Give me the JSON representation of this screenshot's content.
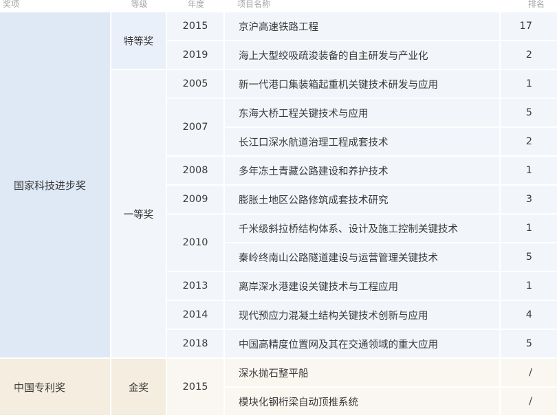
{
  "headers": {
    "award": "奖项",
    "grade": "等级",
    "year": "年度",
    "name": "项目名称",
    "rank": "排名"
  },
  "groups": [
    {
      "award": "国家科技进步奖",
      "grades": [
        {
          "grade": "特等奖",
          "years": [
            {
              "year": "2015",
              "items": [
                {
                  "name": "京沪高速铁路工程",
                  "rank": "17"
                }
              ]
            },
            {
              "year": "2019",
              "items": [
                {
                  "name": "海上大型绞吸疏浚装备的自主研发与产业化",
                  "rank": "2"
                }
              ]
            }
          ]
        },
        {
          "grade": "一等奖",
          "years": [
            {
              "year": "2005",
              "items": [
                {
                  "name": "新一代港口集装箱起重机关键技术研发与应用",
                  "rank": "1"
                }
              ]
            },
            {
              "year": "2007",
              "items": [
                {
                  "name": "东海大桥工程关键技术与应用",
                  "rank": "5"
                },
                {
                  "name": "长江口深水航道治理工程成套技术",
                  "rank": "2"
                }
              ]
            },
            {
              "year": "2008",
              "items": [
                {
                  "name": "多年冻土青藏公路建设和养护技术",
                  "rank": "1"
                }
              ]
            },
            {
              "year": "2009",
              "items": [
                {
                  "name": "膨胀土地区公路修筑成套技术研究",
                  "rank": "3"
                }
              ]
            },
            {
              "year": "2010",
              "items": [
                {
                  "name": "千米级斜拉桥结构体系、设计及施工控制关键技术",
                  "rank": "1"
                },
                {
                  "name": "秦岭终南山公路隧道建设与运营管理关键技术",
                  "rank": "5"
                }
              ]
            },
            {
              "year": "2013",
              "items": [
                {
                  "name": "离岸深水港建设关键技术与工程应用",
                  "rank": "1"
                }
              ]
            },
            {
              "year": "2014",
              "items": [
                {
                  "name": "现代预应力混凝土结构关键技术创新与应用",
                  "rank": "4"
                }
              ]
            },
            {
              "year": "2018",
              "items": [
                {
                  "name": "中国高精度位置网及其在交通领域的重大应用",
                  "rank": "5"
                }
              ]
            }
          ]
        }
      ]
    },
    {
      "award": "中国专利奖",
      "grades": [
        {
          "grade": "金奖",
          "years": [
            {
              "year": "2015",
              "items": [
                {
                  "name": "深水抛石整平船",
                  "rank": "/"
                },
                {
                  "name": "模块化钢桁梁自动顶推系统",
                  "rank": "/"
                }
              ]
            }
          ]
        }
      ]
    }
  ],
  "colors": {
    "blue_dark": "#dfe9f6",
    "blue_mid": "#e9f0f9",
    "blue_light": "#f2f6fb",
    "cream_dark": "#f4ede0",
    "cream_light": "#faf7f0",
    "header_text": "#a5a5a5",
    "body_text": "#3a3a3a"
  }
}
